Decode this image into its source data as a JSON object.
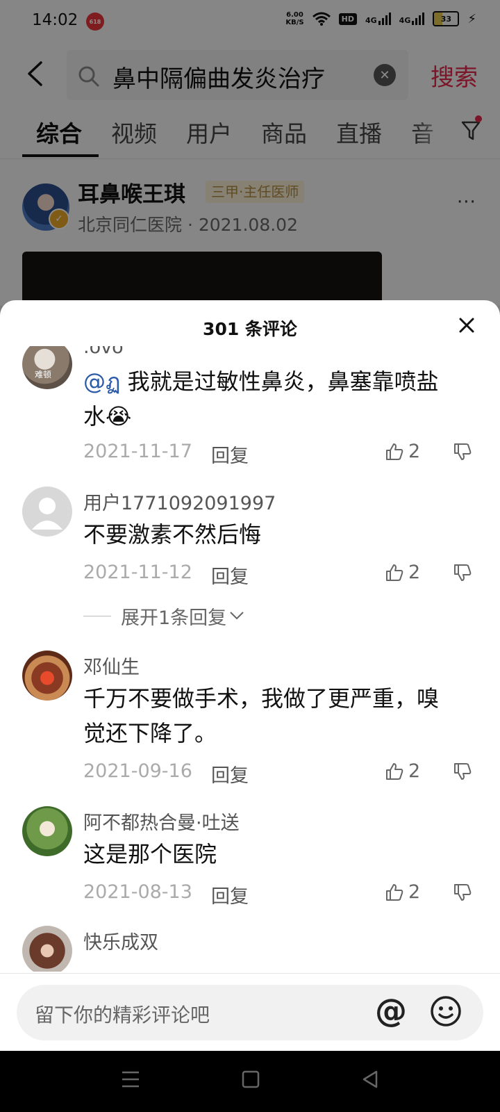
{
  "status_bar": {
    "time": "14:02",
    "badge": "618",
    "speed_value": "6.00",
    "speed_unit": "KB/S",
    "hd": "HD",
    "net1": "4G",
    "net2": "4G",
    "battery": "33"
  },
  "search": {
    "query": "鼻中隔偏曲发炎治疗",
    "submit_label": "搜索"
  },
  "tabs": [
    {
      "label": "综合"
    },
    {
      "label": "视频"
    },
    {
      "label": "用户"
    },
    {
      "label": "商品"
    },
    {
      "label": "直播"
    },
    {
      "label": "音"
    }
  ],
  "post": {
    "author": "耳鼻喉王琪",
    "tag": "三甲·主任医师",
    "meta": "北京同仁医院 · 2021.08.02",
    "more": "···"
  },
  "comment_sheet": {
    "title": "301 条评论",
    "comments": [
      {
        "nickname": ".ovo",
        "avatar_text": "难顿",
        "mention": "@ฏ",
        "text_line1": " 我就是过敏性鼻炎，鼻塞靠喷盐",
        "text_line2": "水😭",
        "date": "2021-11-17",
        "reply_label": "回复",
        "likes": "2"
      },
      {
        "nickname": "用户1771092091997",
        "text": "不要激素不然后悔",
        "date": "2021-11-12",
        "reply_label": "回复",
        "likes": "2",
        "expand_label": "展开1条回复"
      },
      {
        "nickname": "邓仙生",
        "text_line1": "千万不要做手术，我做了更严重，嗅",
        "text_line2": "觉还下降了。",
        "date": "2021-09-16",
        "reply_label": "回复",
        "likes": "2"
      },
      {
        "nickname": "阿不都热合曼·吐送",
        "text": "这是那个医院",
        "date": "2021-08-13",
        "reply_label": "回复",
        "likes": "2"
      },
      {
        "nickname": "快乐成双"
      }
    ]
  },
  "input": {
    "placeholder": "留下你的精彩评论吧",
    "at": "@"
  },
  "colors": {
    "accent": "#e0284a",
    "mention": "#2a5aa8",
    "tag_bg": "#f6ecd4",
    "tag_text": "#b08a3e"
  }
}
